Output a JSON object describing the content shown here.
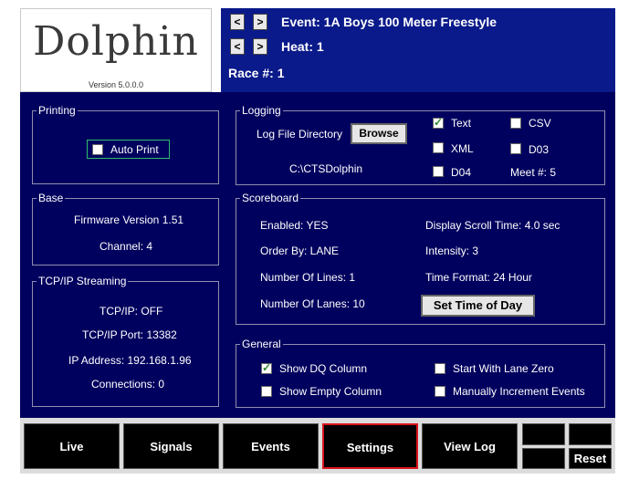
{
  "logo": {
    "wordmark": "Dolphin",
    "version": "Version 5.0.0.0"
  },
  "header": {
    "event_label": "Event: 1A  Boys 100 Meter Freestyle",
    "heat_label": "Heat: 1",
    "race_label": "Race #: 1",
    "prev_glyph": "<",
    "next_glyph": ">"
  },
  "printing": {
    "legend": "Printing",
    "auto_print_label": "Auto Print",
    "auto_print_checked": false
  },
  "logging": {
    "legend": "Logging",
    "dir_label": "Log File Directory",
    "browse_label": "Browse",
    "path": "C:\\CTSDolphin",
    "text_label": "Text",
    "text_checked": true,
    "csv_label": "CSV",
    "csv_checked": false,
    "xml_label": "XML",
    "xml_checked": false,
    "d03_label": "D03",
    "d03_checked": false,
    "d04_label": "D04",
    "d04_checked": false,
    "meet_label": "Meet #: 5"
  },
  "base": {
    "legend": "Base",
    "firmware": "Firmware Version  1.51",
    "channel": "Channel: 4"
  },
  "scoreboard": {
    "legend": "Scoreboard",
    "enabled": "Enabled: YES",
    "order_by": "Order By: LANE",
    "num_lines": "Number Of Lines: 1",
    "num_lanes": "Number Of Lanes: 10",
    "scroll_time": "Display Scroll Time: 4.0 sec",
    "intensity": "Intensity: 3",
    "time_format": "Time Format: 24 Hour",
    "set_time_label": "Set Time of Day"
  },
  "tcpip": {
    "legend": "TCP/IP Streaming",
    "status": "TCP/IP: OFF",
    "port": "TCP/IP Port: 13382",
    "ip": "IP Address: 192.168.1.96",
    "connections": "Connections: 0"
  },
  "general": {
    "legend": "General",
    "show_dq_label": "Show DQ Column",
    "show_dq_checked": true,
    "show_empty_label": "Show Empty Column",
    "show_empty_checked": false,
    "lane_zero_label": "Start With Lane Zero",
    "lane_zero_checked": false,
    "manual_inc_label": "Manually Increment Events",
    "manual_inc_checked": false
  },
  "tabs": [
    {
      "label": "Live"
    },
    {
      "label": "Signals"
    },
    {
      "label": "Events"
    },
    {
      "label": "Settings",
      "active": true
    },
    {
      "label": "View Log"
    }
  ],
  "reset_label": "Reset",
  "colors": {
    "panel": "#00005e",
    "header": "#0a1a8a",
    "active_tab_border": "#d9141e",
    "check": "#2e8b2e"
  }
}
